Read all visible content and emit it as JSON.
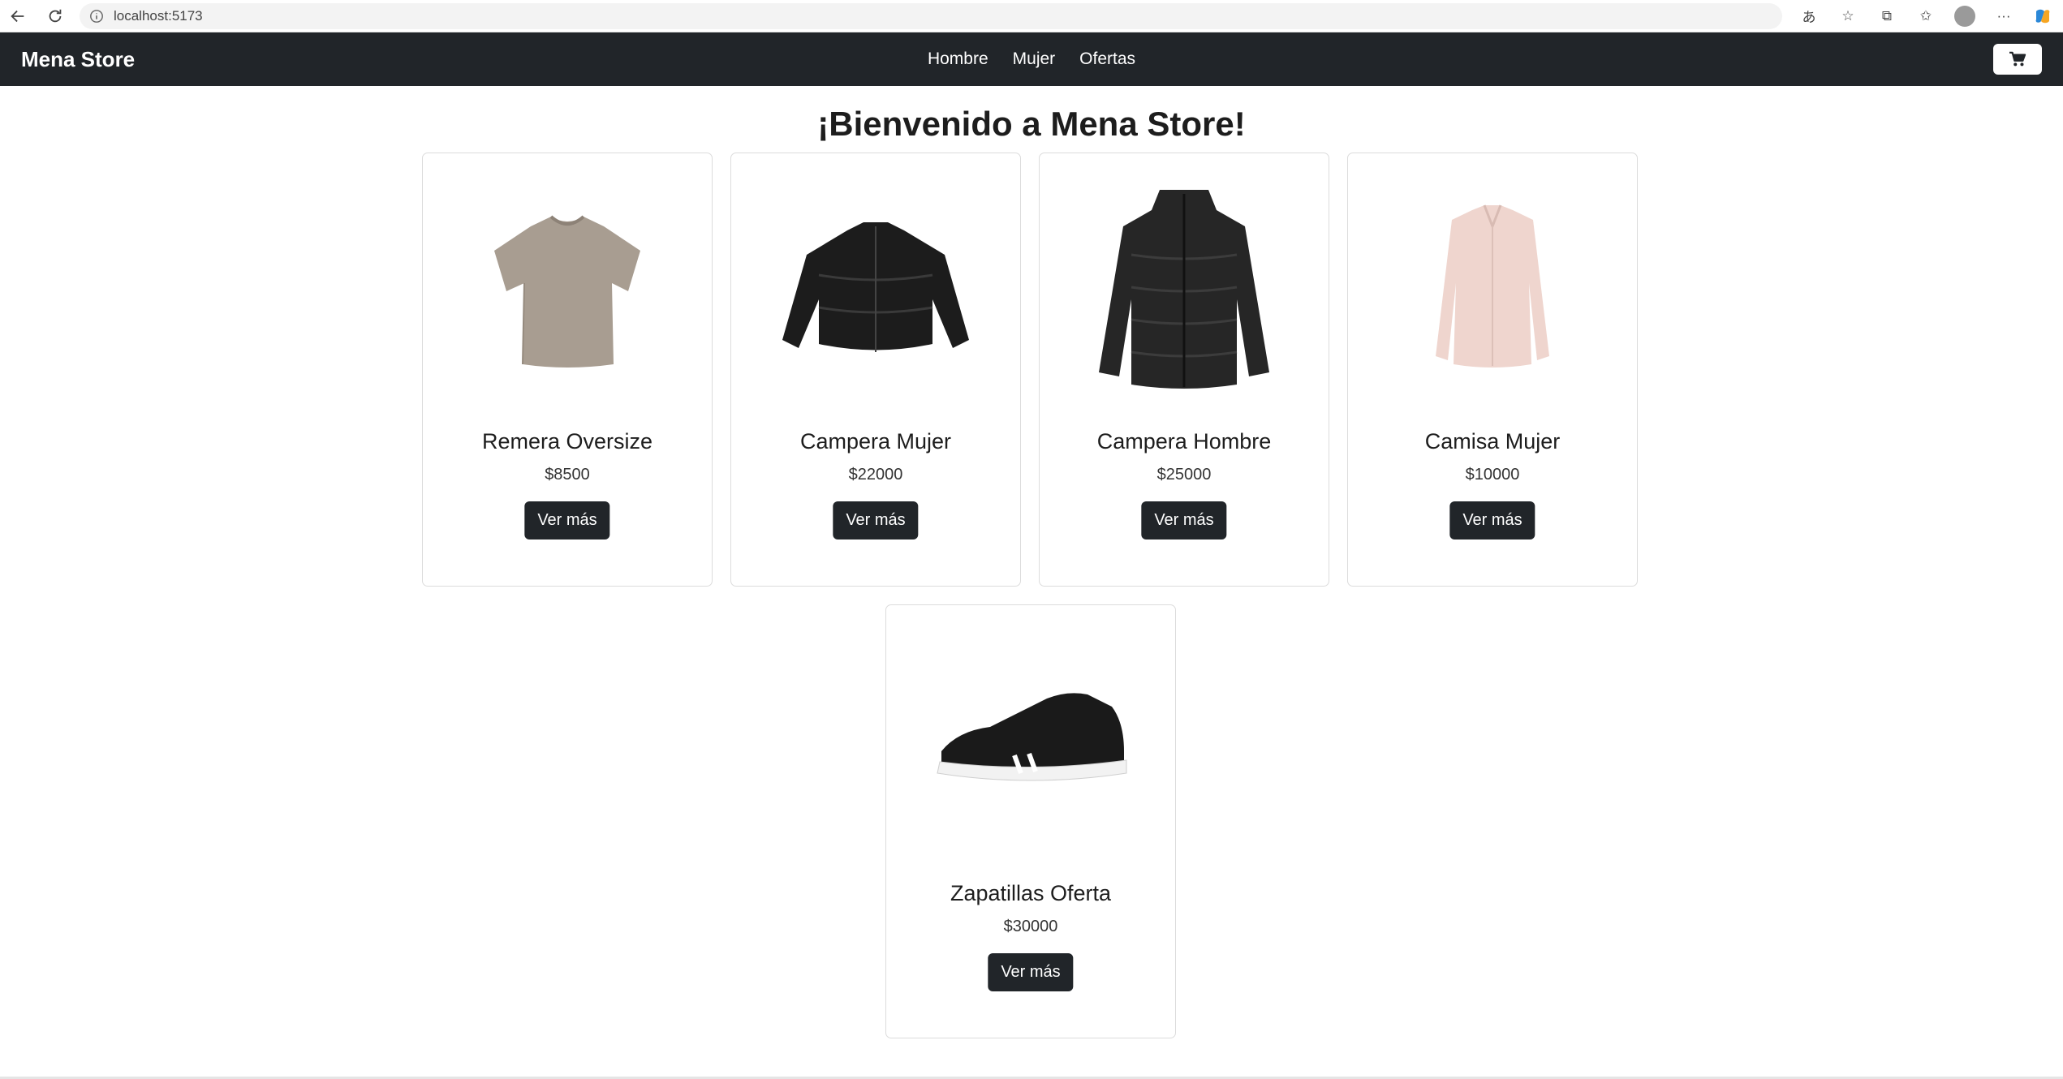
{
  "browser": {
    "url": "localhost:5173",
    "right_icons": [
      "translate-icon",
      "star-icon",
      "extensions-icon",
      "favorites-icon",
      "profile-avatar",
      "more-icon",
      "copilot-icon"
    ]
  },
  "navbar": {
    "brand": "Mena Store",
    "links": [
      "Hombre",
      "Mujer",
      "Ofertas"
    ],
    "cart_icon": "cart-icon",
    "bg_color": "#212529"
  },
  "main": {
    "heading": "¡Bienvenido a Mena Store!",
    "products": [
      {
        "name": "Remera Oversize",
        "price": "$8500",
        "button": "Ver más",
        "image": "tshirt-image"
      },
      {
        "name": "Campera Mujer",
        "price": "$22000",
        "button": "Ver más",
        "image": "puffer-jacket-women-image"
      },
      {
        "name": "Campera Hombre",
        "price": "$25000",
        "button": "Ver más",
        "image": "puffer-jacket-men-image"
      },
      {
        "name": "Camisa Mujer",
        "price": "$10000",
        "button": "Ver más",
        "image": "shirt-image"
      },
      {
        "name": "Zapatillas Oferta",
        "price": "$30000",
        "button": "Ver más",
        "image": "sneaker-image"
      }
    ]
  }
}
